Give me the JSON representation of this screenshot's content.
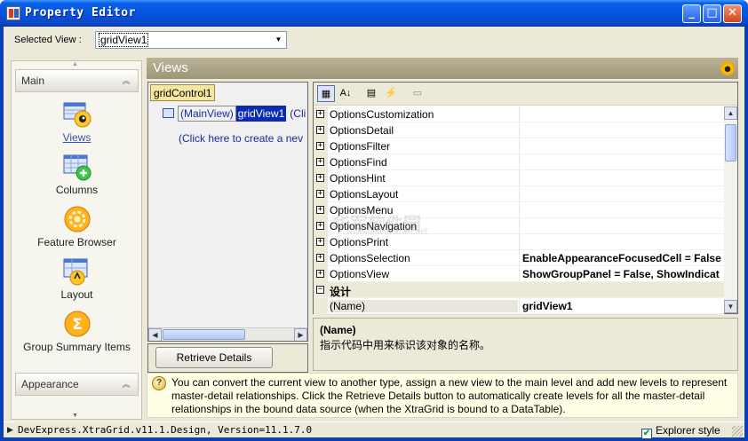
{
  "window": {
    "title": "Property Editor",
    "minimize_glyph": "_",
    "maximize_glyph": "□",
    "close_glyph": "✕"
  },
  "selected_view": {
    "label": "Selected View :",
    "value": "gridView1",
    "arrow": "▼"
  },
  "navbar": {
    "scroll_up": "▲",
    "scroll_down": "▼",
    "groups": [
      {
        "label": "Main",
        "collapse_icon": "chevron-up-double-icon",
        "collapse_glyph": "︽"
      },
      {
        "label": "Appearance",
        "collapse_icon": "chevron-up-double-icon",
        "collapse_glyph": "︽"
      }
    ],
    "items": [
      {
        "label": "Views",
        "icon": "views-icon",
        "active": true
      },
      {
        "label": "Columns",
        "icon": "columns-icon",
        "active": false
      },
      {
        "label": "Feature Browser",
        "icon": "feature-browser-icon",
        "active": false
      },
      {
        "label": "Layout",
        "icon": "layout-icon",
        "active": false
      },
      {
        "label": "Group Summary Items",
        "icon": "group-summary-icon",
        "active": false
      }
    ]
  },
  "views_panel": {
    "title": "Views",
    "tree": {
      "grid_control": "gridControl1",
      "main_view": "(MainView)",
      "grid_view": "gridView1",
      "link_stub": "(Cli",
      "create_text": "(Click here to create a nev"
    },
    "scroll_left": "◀",
    "scroll_right": "▶",
    "retrieve_button": "Retrieve Details"
  },
  "property_grid": {
    "toolbar": [
      {
        "icon": "categorized-icon",
        "glyph": "▦",
        "pressed": true
      },
      {
        "icon": "alphabetical-sort-icon",
        "glyph": "A↓",
        "pressed": false
      },
      {
        "icon": "properties-icon",
        "glyph": "▤",
        "pressed": false
      },
      {
        "icon": "events-icon",
        "glyph": "⚡",
        "pressed": false
      },
      {
        "icon": "property-pages-icon",
        "glyph": "▭",
        "pressed": false
      }
    ],
    "rows": [
      {
        "name": "OptionsCustomization",
        "value": "",
        "expander": "+",
        "kind": "prop"
      },
      {
        "name": "OptionsDetail",
        "value": "",
        "expander": "+",
        "kind": "prop"
      },
      {
        "name": "OptionsFilter",
        "value": "",
        "expander": "+",
        "kind": "prop"
      },
      {
        "name": "OptionsFind",
        "value": "",
        "expander": "+",
        "kind": "prop"
      },
      {
        "name": "OptionsHint",
        "value": "",
        "expander": "+",
        "kind": "prop"
      },
      {
        "name": "OptionsLayout",
        "value": "",
        "expander": "+",
        "kind": "prop"
      },
      {
        "name": "OptionsMenu",
        "value": "",
        "expander": "+",
        "kind": "prop"
      },
      {
        "name": "OptionsNavigation",
        "value": "",
        "expander": "+",
        "kind": "prop"
      },
      {
        "name": "OptionsPrint",
        "value": "",
        "expander": "+",
        "kind": "prop"
      },
      {
        "name": "OptionsSelection",
        "value": "EnableAppearanceFocusedCell = False",
        "expander": "+",
        "kind": "prop"
      },
      {
        "name": "OptionsView",
        "value": "ShowGroupPanel = False, ShowIndicat",
        "expander": "+",
        "kind": "prop"
      },
      {
        "name": "设计",
        "value": "",
        "expander": "−",
        "kind": "category"
      },
      {
        "name": "(Name)",
        "value": "gridView1",
        "expander": "",
        "kind": "selected"
      }
    ],
    "scroll_up": "▲",
    "scroll_down": "▼",
    "description": {
      "title": "(Name)",
      "text": "指示代码中用来标识该对象的名称。"
    }
  },
  "watermark": {
    "text": "华军软件园",
    "sub": "www.onlinedown.net"
  },
  "hint": {
    "icon": "lightbulb-icon",
    "icon_glyph": "?",
    "text": "You can convert the current view to another type, assign a new view to the main level and add new levels to represent master-detail relationships. Click the Retrieve Details button to automatically create levels for all the master-detail relationships in the bound data source (when the XtraGrid is bound to a DataTable)."
  },
  "statusbar": {
    "arrow": "▶",
    "text": "DevExpress.XtraGrid.v11.1.Design, Version=11.1.7.0",
    "explorer_style": {
      "label": "Explorer style",
      "checked": true,
      "check_glyph": "✔"
    }
  }
}
